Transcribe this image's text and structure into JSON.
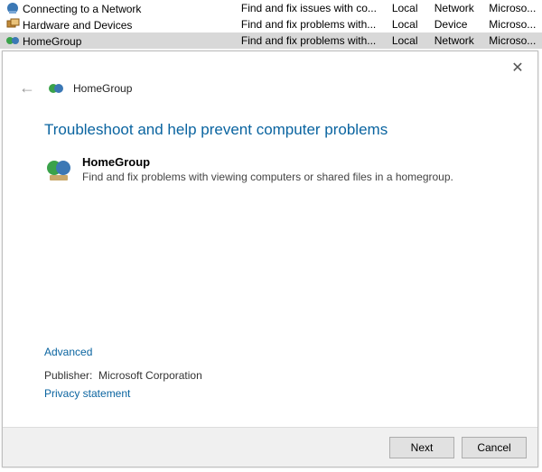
{
  "table": {
    "rows": [
      {
        "name": "Connecting to a Network",
        "desc": "Find and fix issues with co...",
        "loc": "Local",
        "cat": "Network",
        "pub": "Microso..."
      },
      {
        "name": "Hardware and Devices",
        "desc": "Find and fix problems with...",
        "loc": "Local",
        "cat": "Device",
        "pub": "Microso..."
      },
      {
        "name": "HomeGroup",
        "desc": "Find and fix problems with...",
        "loc": "Local",
        "cat": "Network",
        "pub": "Microso...",
        "selected": true
      }
    ]
  },
  "wizard": {
    "breadcrumb": "HomeGroup",
    "heading": "Troubleshoot and help prevent computer problems",
    "item_title": "HomeGroup",
    "item_desc": "Find and fix problems with viewing computers or shared files in a homegroup.",
    "advanced": "Advanced",
    "publisher_label": "Publisher:",
    "publisher_value": "Microsoft Corporation",
    "privacy": "Privacy statement",
    "next": "Next",
    "cancel": "Cancel"
  }
}
